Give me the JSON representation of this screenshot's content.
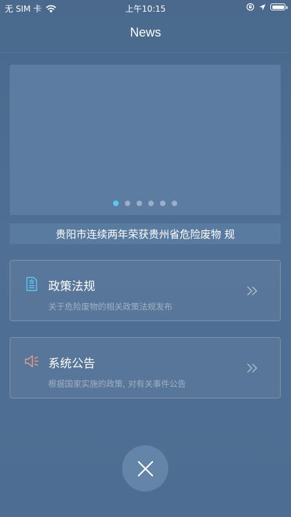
{
  "status_bar": {
    "carrier": "无 SIM 卡",
    "time": "上午10:15"
  },
  "nav": {
    "title": "News"
  },
  "banner": {
    "page_count": 6,
    "active_page": 1
  },
  "headline": {
    "text": "贵阳市连续两年荣获贵州省危险废物 规"
  },
  "cards": [
    {
      "title": "政策法规",
      "description": "关于危险废物的相关政策法规发布",
      "icon": "policy-document-icon",
      "icon_color": "#5ec8f3"
    },
    {
      "title": "系统公告",
      "description": "根据国家实施的政策, 对有关事件公告",
      "icon": "speaker-icon",
      "icon_color": "#f0a085"
    }
  ],
  "colors": {
    "background": "#4f6f94",
    "accent": "#5ec8f3"
  }
}
